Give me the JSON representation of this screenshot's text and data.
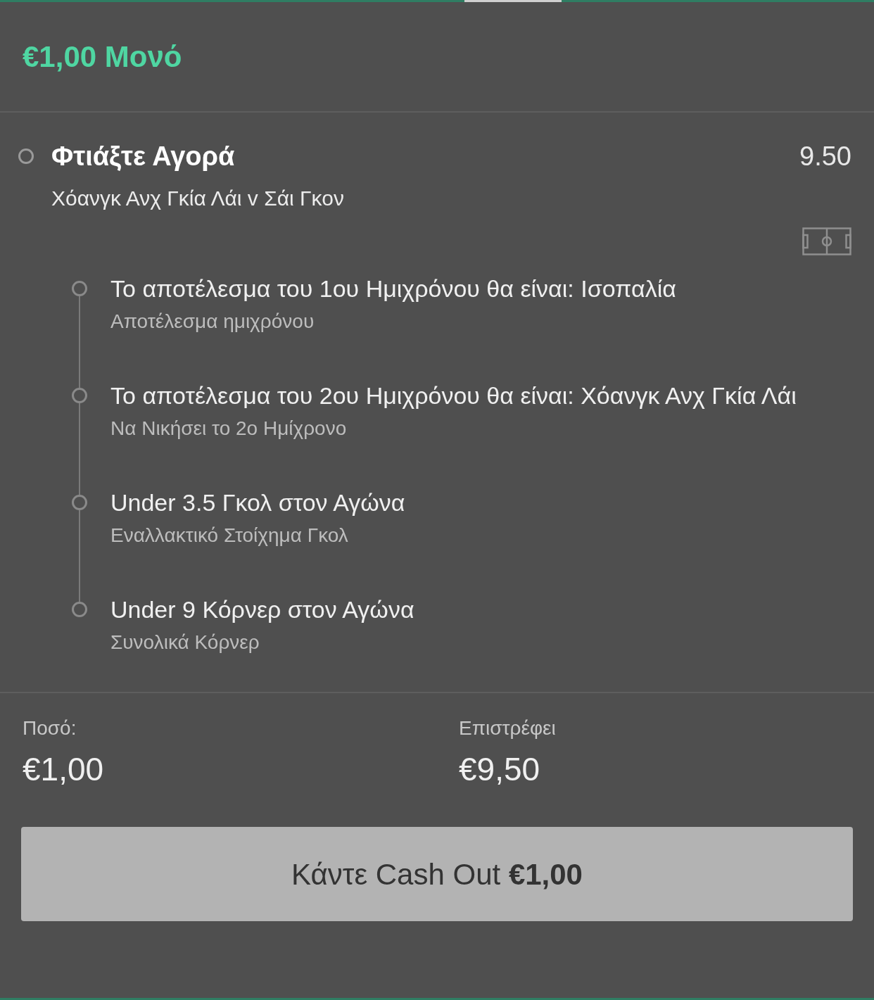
{
  "header": {
    "title": "€1,00 Μονό"
  },
  "selection": {
    "title": "Φτιάξτε Αγορά",
    "odds": "9.50",
    "event": "Χόανγκ Ανχ Γκία Λάι v Σάι Γκον",
    "legs": [
      {
        "title": "Το αποτέλεσμα του 1ου Ημιχρόνου θα είναι: Ισοπαλία",
        "market": "Αποτέλεσμα ημιχρόνου"
      },
      {
        "title": "Το αποτέλεσμα του 2ου Ημιχρόνου θα είναι: Χόανγκ Ανχ Γκία Λάι",
        "market": "Να Νικήσει το 2ο Ημίχρονο"
      },
      {
        "title": "Under 3.5 Γκολ στον Αγώνα",
        "market": "Εναλλακτικό Στοίχημα Γκολ"
      },
      {
        "title": "Under 9 Κόρνερ στον Αγώνα",
        "market": "Συνολικά Κόρνερ"
      }
    ]
  },
  "summary": {
    "stake_label": "Ποσό:",
    "stake": "€1,00",
    "returns_label": "Επιστρέφει",
    "returns": "€9,50"
  },
  "cash_out_button": "Κάντε Cash Out **€1,00**"
}
